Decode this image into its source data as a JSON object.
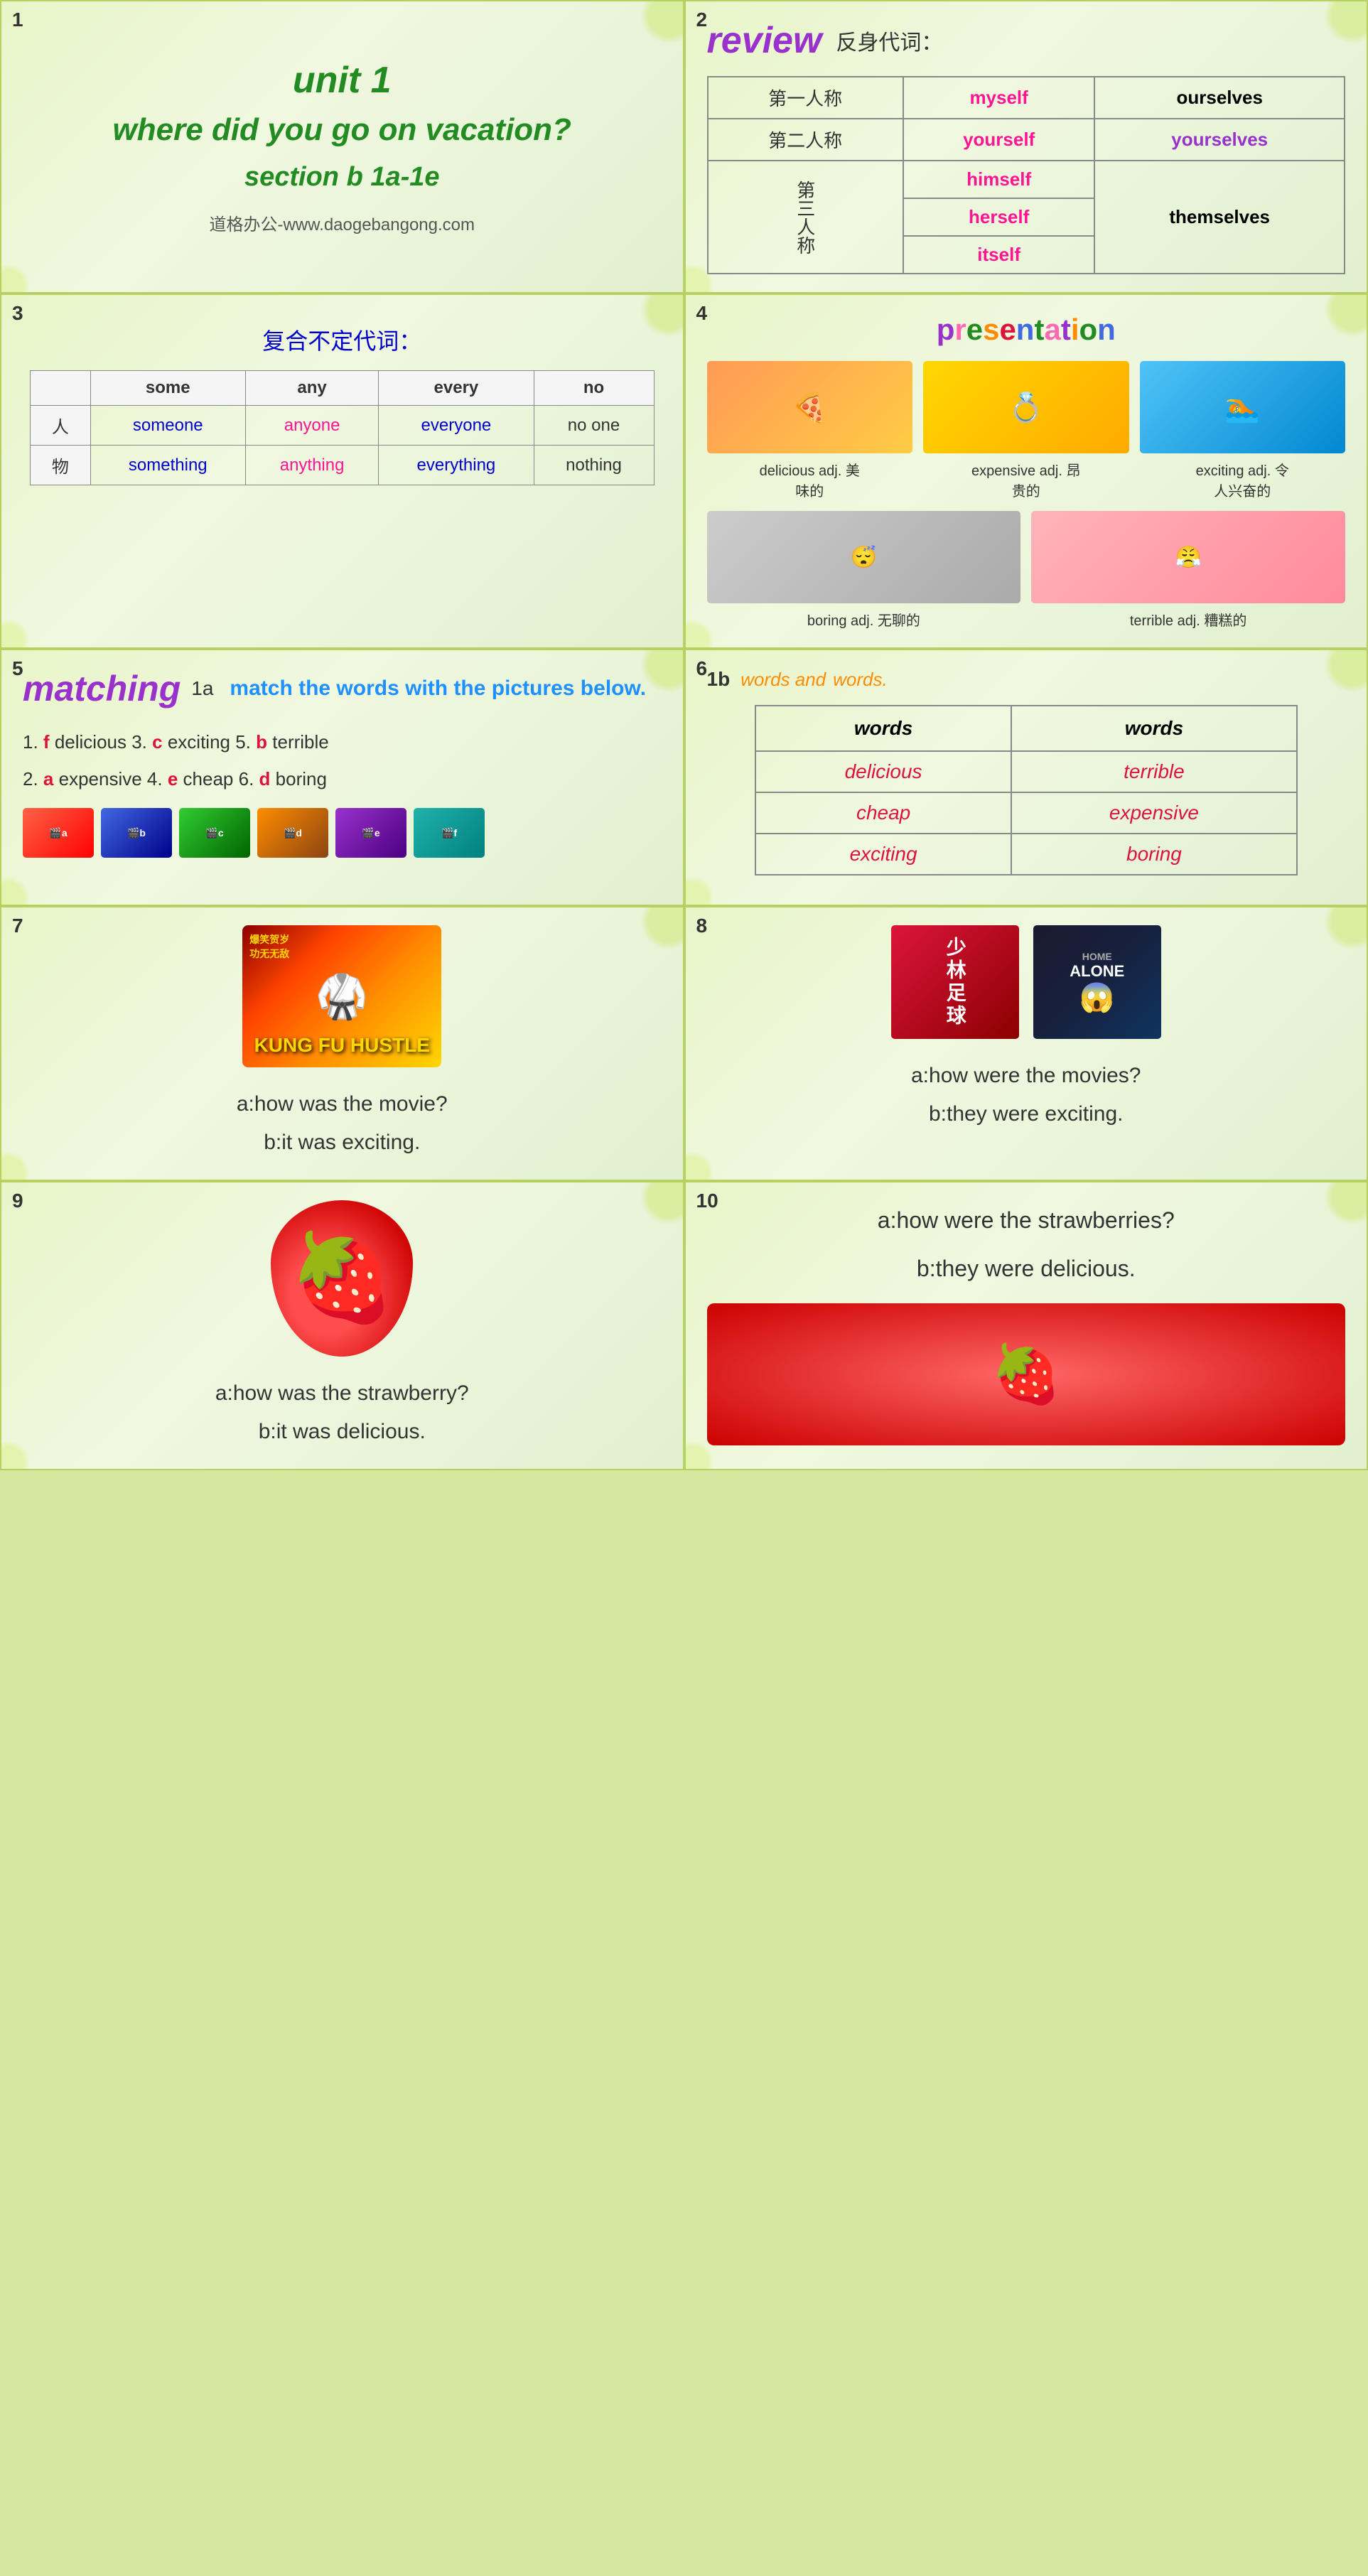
{
  "cells": {
    "cell1": {
      "number": "1",
      "unit": "unit 1",
      "main_title": "where did you go on vacation?",
      "section": "section b  1a-1e",
      "website": "道格办公-www.daogebangong.com"
    },
    "cell2": {
      "number": "2",
      "review_word": "review",
      "subtitle": "反身代词：",
      "rows": [
        {
          "label": "第一人称",
          "col1": "myself",
          "col1_color": "pink",
          "col2": "ourselves",
          "col2_color": "black"
        },
        {
          "label": "第二人称",
          "col1": "yourself",
          "col1_color": "pink",
          "col2": "yourselves",
          "col2_color": "purple"
        },
        {
          "label": "himself",
          "col1_color": "pink"
        },
        {
          "label3": "第三人称",
          "col1": "herself",
          "col1_color": "pink",
          "col2": "themselves",
          "col2_color": "black"
        },
        {
          "col1": "itself",
          "col1_color": "pink"
        }
      ]
    },
    "cell3": {
      "number": "3",
      "title": "复合不定代词：",
      "headers": [
        "some",
        "any",
        "every",
        "no"
      ],
      "row1_label": "人",
      "row1": [
        "someone",
        "anyone",
        "everyone",
        "no one"
      ],
      "row2_label": "物",
      "row2": [
        "something",
        "anything",
        "everything",
        "nothing"
      ]
    },
    "cell4": {
      "number": "4",
      "title": "presentation",
      "items": [
        {
          "label": "delicious adj. 美味的",
          "emoji": "🍕"
        },
        {
          "label": "expensive adj. 昂贵的",
          "emoji": "💎"
        },
        {
          "label": "exciting adj. 令人兴奋的",
          "emoji": "🏊"
        },
        {
          "label": "boring adj. 无聊的",
          "emoji": "😴"
        },
        {
          "label": "terrible adj. 糟糕的",
          "emoji": "😣"
        }
      ]
    },
    "cell5": {
      "number": "5",
      "matching_word": "matching",
      "task_label": "1a",
      "task_desc": "match the words with the pictures below.",
      "items": [
        {
          "num": "1.",
          "answer": "f",
          "word": "delicious"
        },
        {
          "num": "3.",
          "answer": "c",
          "word": "exciting"
        },
        {
          "num": "5.",
          "answer": "b",
          "word": "terrible"
        },
        {
          "num": "2.",
          "answer": "a",
          "word": "expensive"
        },
        {
          "num": "4.",
          "answer": "e",
          "word": "cheap"
        },
        {
          "num": "6.",
          "answer": "d",
          "word": "boring"
        }
      ]
    },
    "cell6": {
      "number": "6",
      "task_label": "1b",
      "header_text1": "words and",
      "header_text2": "words.",
      "col1_header": "words",
      "col2_header": "words",
      "rows": [
        {
          "col1": "delicious",
          "col2": "terrible"
        },
        {
          "col1": "cheap",
          "col2": "expensive"
        },
        {
          "col1": "exciting",
          "col2": "boring"
        }
      ]
    },
    "cell7": {
      "number": "7",
      "poster_line1": "爆笑贺岁",
      "poster_line2": "功无无敌",
      "poster_movie": "KUNG FU HUSTLE",
      "dialog_a": "a:how was the movie?",
      "dialog_b": "b:it was exciting."
    },
    "cell8": {
      "number": "8",
      "poster1_text": "少林足球",
      "poster2_text": "HOME ALONE",
      "dialog_a": "a:how were  the movies?",
      "dialog_b": "b:they were exciting."
    },
    "cell9": {
      "number": "9",
      "dialog_a": "a:how was the strawberry?",
      "dialog_b": "b:it was delicious."
    },
    "cell10": {
      "number": "10",
      "dialog_a": "a:how were the strawberries?",
      "dialog_b": "b:they were delicious."
    }
  }
}
